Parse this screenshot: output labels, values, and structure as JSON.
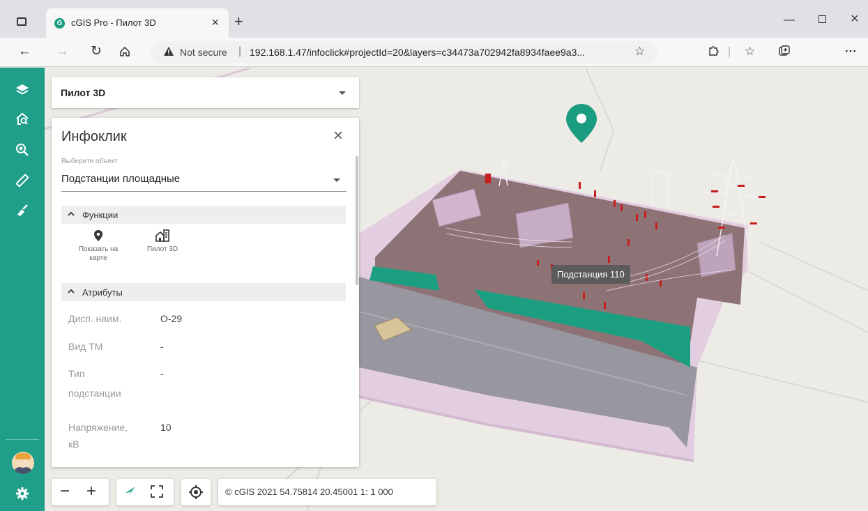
{
  "browser": {
    "tab_title": "cGIS Pro - Пилот 3D",
    "tab_favicon_letter": "G",
    "new_tab_label": "+",
    "security_label": "Not secure",
    "url": "192.168.1.47/infoclick#projectId=20&layers=c34473a702942fa8934faee9a3..."
  },
  "app": {
    "project": {
      "name": "Пилот 3D"
    },
    "infoclick": {
      "title": "Инфоклик",
      "select_label": "Выберите объект",
      "select_value": "Подстанции площадные",
      "functions_header": "Функции",
      "functions": [
        {
          "label_line1": "Показать на",
          "label_line2": "карте",
          "icon": "location-pin-icon"
        },
        {
          "label_line1": "Пилот 3D",
          "label_line2": "",
          "icon": "building-3d-icon"
        }
      ],
      "attributes_header": "Атрибуты",
      "attributes": [
        {
          "key_line1": "Дисп. наим.",
          "key_line2": "",
          "value": "О-29"
        },
        {
          "key_line1": "Вид ТМ",
          "key_line2": "",
          "value": "-"
        },
        {
          "key_line1": "Тип",
          "key_line2": "подстанции",
          "value": "-"
        },
        {
          "key_line1": "Напряжение,",
          "key_line2": "кВ",
          "value": "10"
        }
      ]
    },
    "map": {
      "tooltip": "Подстанция 110"
    },
    "toolbar": {
      "zoom_out_label": "−",
      "zoom_in_label": "+",
      "status": "© cGIS 2021 54.75814 20.45001 1: 1 000"
    },
    "colors": {
      "accent": "#1f9e8a",
      "map_background": "#edebe6",
      "site_platform": "#e3cde0",
      "site_ground": "#8e7376",
      "road": "#9897a0",
      "grass": "#1c9e80"
    }
  }
}
